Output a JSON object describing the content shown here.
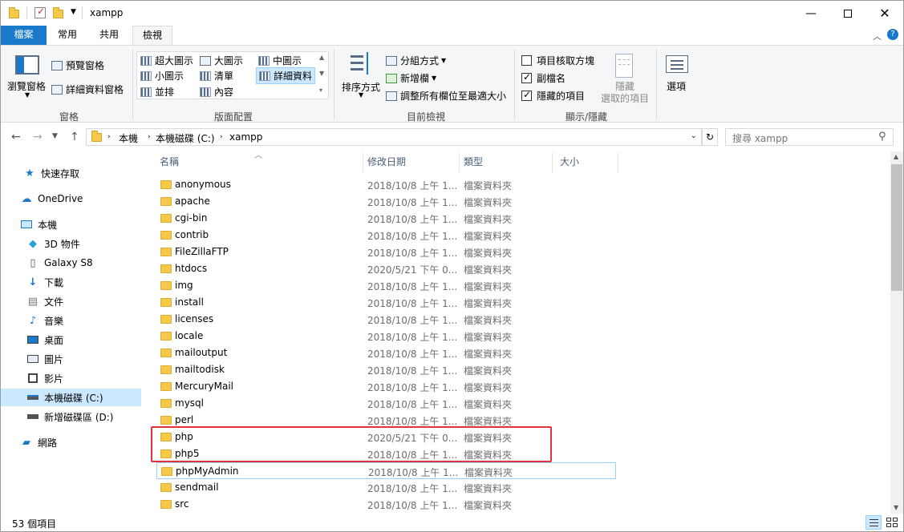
{
  "window": {
    "title": "xampp"
  },
  "tabs": {
    "file": "檔案",
    "home": "常用",
    "share": "共用",
    "view": "檢視"
  },
  "ribbon": {
    "panes": {
      "nav_pane": "瀏覽窗格",
      "preview": "預覽窗格",
      "details": "詳細資料窗格",
      "label": "窗格"
    },
    "layout": {
      "items": [
        "超大圖示",
        "大圖示",
        "中圖示",
        "小圖示",
        "清單",
        "詳細資料",
        "並排",
        "內容"
      ],
      "selected": "詳細資料",
      "label": "版面配置"
    },
    "current_view": {
      "sort_by": "排序方式",
      "group_by": "分組方式",
      "add_column": "新增欄",
      "size_columns": "調整所有欄位至最適大小",
      "label": "目前檢視"
    },
    "show_hide": {
      "item_checkboxes": "項目核取方塊",
      "file_extensions": "副檔名",
      "hidden_items": "隱藏的項目",
      "hide_selected_l1": "隱藏",
      "hide_selected_l2": "選取的項目",
      "label": "顯示/隱藏",
      "checks": {
        "item_checkboxes": false,
        "file_extensions": true,
        "hidden_items": true
      }
    },
    "options": "選項"
  },
  "address": {
    "crumbs": [
      "本機",
      "本機磁碟 (C:)",
      "xampp"
    ],
    "search_placeholder": "搜尋 xampp"
  },
  "navpane": {
    "items": [
      {
        "label": "快速存取",
        "icon": "star-icon"
      },
      {
        "label": "OneDrive",
        "icon": "cloud-icon"
      },
      {
        "label": "本機",
        "icon": "computer-icon"
      },
      {
        "label": "3D 物件",
        "icon": "cube-icon"
      },
      {
        "label": "Galaxy S8",
        "icon": "phone-icon"
      },
      {
        "label": "下載",
        "icon": "download-icon"
      },
      {
        "label": "文件",
        "icon": "document-icon"
      },
      {
        "label": "音樂",
        "icon": "music-icon"
      },
      {
        "label": "桌面",
        "icon": "desktop-icon"
      },
      {
        "label": "圖片",
        "icon": "picture-icon"
      },
      {
        "label": "影片",
        "icon": "video-icon"
      },
      {
        "label": "本機磁碟 (C:)",
        "icon": "drive-icon"
      },
      {
        "label": "新增磁碟區 (D:)",
        "icon": "drive-icon"
      },
      {
        "label": "網路",
        "icon": "network-icon"
      }
    ],
    "selected": "本機磁碟 (C:)"
  },
  "columns": {
    "name": "名稱",
    "date": "修改日期",
    "type": "類型",
    "size": "大小"
  },
  "files": [
    {
      "name": "anonymous",
      "date": "2018/10/8 上午 1...",
      "type": "檔案資料夾"
    },
    {
      "name": "apache",
      "date": "2018/10/8 上午 1...",
      "type": "檔案資料夾"
    },
    {
      "name": "cgi-bin",
      "date": "2018/10/8 上午 1...",
      "type": "檔案資料夾"
    },
    {
      "name": "contrib",
      "date": "2018/10/8 上午 1...",
      "type": "檔案資料夾"
    },
    {
      "name": "FileZillaFTP",
      "date": "2018/10/8 上午 1...",
      "type": "檔案資料夾"
    },
    {
      "name": "htdocs",
      "date": "2020/5/21 下午 0...",
      "type": "檔案資料夾"
    },
    {
      "name": "img",
      "date": "2018/10/8 上午 1...",
      "type": "檔案資料夾"
    },
    {
      "name": "install",
      "date": "2018/10/8 上午 1...",
      "type": "檔案資料夾"
    },
    {
      "name": "licenses",
      "date": "2018/10/8 上午 1...",
      "type": "檔案資料夾"
    },
    {
      "name": "locale",
      "date": "2018/10/8 上午 1...",
      "type": "檔案資料夾"
    },
    {
      "name": "mailoutput",
      "date": "2018/10/8 上午 1...",
      "type": "檔案資料夾"
    },
    {
      "name": "mailtodisk",
      "date": "2018/10/8 上午 1...",
      "type": "檔案資料夾"
    },
    {
      "name": "MercuryMail",
      "date": "2018/10/8 上午 1...",
      "type": "檔案資料夾"
    },
    {
      "name": "mysql",
      "date": "2018/10/8 上午 1...",
      "type": "檔案資料夾"
    },
    {
      "name": "perl",
      "date": "2018/10/8 上午 1...",
      "type": "檔案資料夾"
    },
    {
      "name": "php",
      "date": "2020/5/21 下午 0...",
      "type": "檔案資料夾"
    },
    {
      "name": "php5",
      "date": "2018/10/8 上午 1...",
      "type": "檔案資料夾"
    },
    {
      "name": "phpMyAdmin",
      "date": "2018/10/8 上午 1...",
      "type": "檔案資料夾"
    },
    {
      "name": "sendmail",
      "date": "2018/10/8 上午 1...",
      "type": "檔案資料夾"
    },
    {
      "name": "src",
      "date": "2018/10/8 上午 1...",
      "type": "檔案資料夾"
    }
  ],
  "hovered_file": "phpMyAdmin",
  "status": {
    "count": "53 個項目"
  },
  "colors": {
    "accent": "#1979ca",
    "highlight": "#e2333b",
    "selected": "#cce8ff",
    "folder": "#f6c94b"
  }
}
